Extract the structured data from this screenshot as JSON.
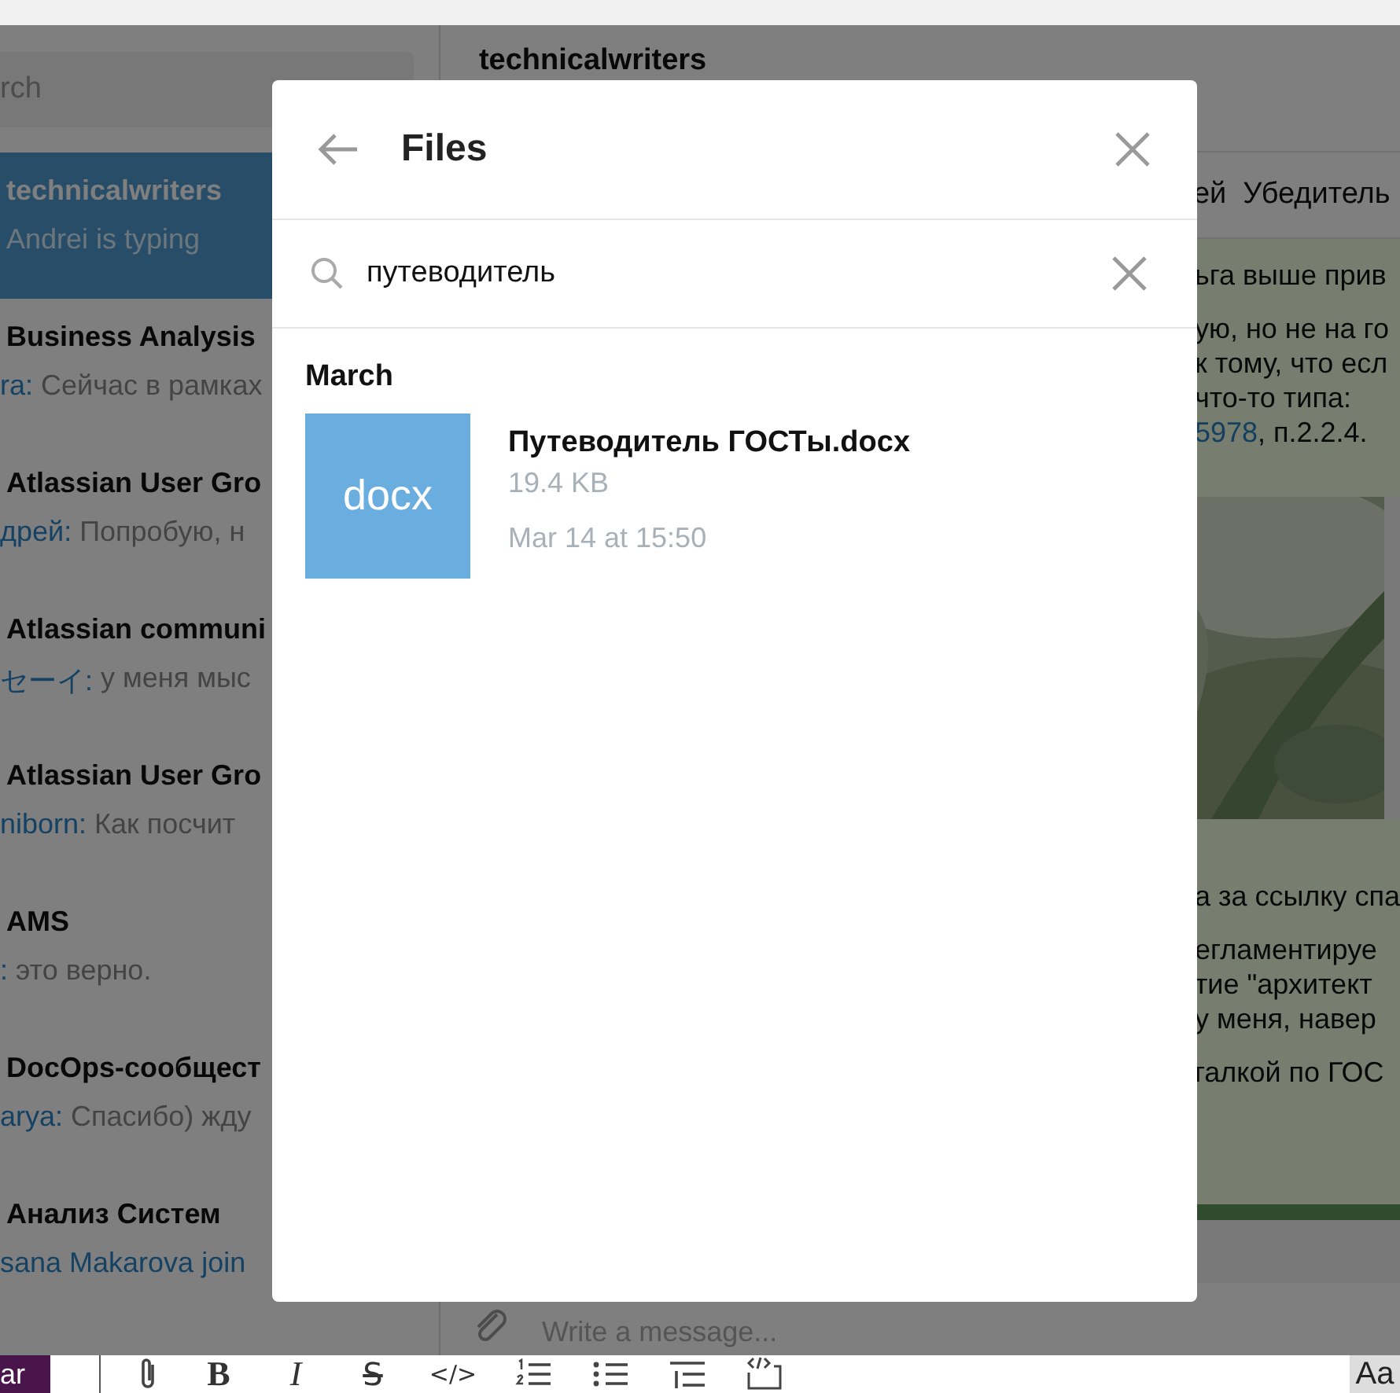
{
  "sidebar": {
    "search": {
      "placeholder": "rch"
    },
    "chats": [
      {
        "title": "technicalwriters",
        "preview": "Andrei is typing",
        "selected": true
      },
      {
        "title": "Business Analysis",
        "sender": "ra:",
        "preview": "Сейчас в рамках",
        "selected": false
      },
      {
        "title": "Atlassian User Gro",
        "sender": "дрей:",
        "preview": "Попробую, н",
        "selected": false
      },
      {
        "title": "Atlassian communi",
        "sender": "セーイ:",
        "preview": "у меня мыс",
        "selected": false
      },
      {
        "title": "Atlassian User Gro",
        "sender": "niborn:",
        "preview": "Как посчит",
        "selected": false
      },
      {
        "title": "AMS",
        "sender": ":",
        "preview": "это верно.",
        "selected": false
      },
      {
        "title": "DocOps-сообщест",
        "sender": "arya:",
        "preview": "Спасибо) жду",
        "selected": false
      },
      {
        "title": "Анализ Систем",
        "sender": "sana Makarova join",
        "selected": false
      }
    ]
  },
  "chat": {
    "title": "technicalwriters",
    "pinned": "ей  Убедитель",
    "messages": [
      {
        "kind": "text",
        "paragraphs": [
          [
            {
              "text": "ьга выше прив"
            }
          ],
          [
            {
              "text": "ую, но не на го"
            },
            {
              "text": "к тому, что есл"
            },
            {
              "text": "что-то типа:"
            },
            {
              "link": "5978",
              "text": ", п.2.2.4."
            }
          ]
        ]
      },
      {
        "kind": "picture"
      },
      {
        "kind": "text",
        "paragraphs": [
          [
            {
              "text": "а за ссылку спа"
            }
          ],
          [
            {
              "text": "егламентируе"
            },
            {
              "text": "тие \"архитект"
            },
            {
              "text": "у меня, навер"
            }
          ],
          [
            {
              "text": "галкой по ГОС"
            }
          ]
        ]
      }
    ],
    "compose": {
      "placeholder": "Write a message..."
    }
  },
  "modal": {
    "title": "Files",
    "search": {
      "value": "путеводитель"
    },
    "section": "March",
    "files": [
      {
        "ext": "docx",
        "name": "Путеводитель ГОСТы.docx",
        "size": "19.4 KB",
        "date": "Mar 14 at 15:50"
      }
    ]
  },
  "toolbar": {
    "workspace": "ar",
    "items": [
      {
        "kind": "attach"
      },
      {
        "kind": "bold",
        "label": "B"
      },
      {
        "kind": "italic",
        "label": "I"
      },
      {
        "kind": "strike",
        "label": "S"
      },
      {
        "kind": "code",
        "label": "</>"
      },
      {
        "kind": "ordered_list"
      },
      {
        "kind": "bullet_list"
      },
      {
        "kind": "indent"
      },
      {
        "kind": "code_block"
      }
    ],
    "format": "Aa"
  }
}
